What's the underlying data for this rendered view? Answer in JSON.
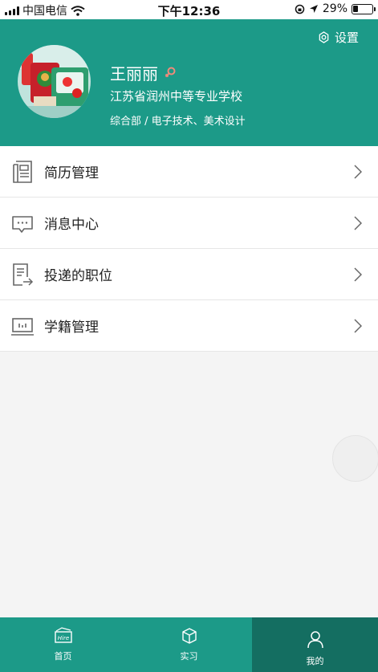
{
  "status_bar": {
    "carrier": "中国电信",
    "time": "下午12:36",
    "battery": "29%",
    "battery_level": 0.29
  },
  "header": {
    "settings_label": "设置",
    "name": "王丽丽",
    "school": "江苏省润州中等专业学校",
    "department": "综合部 / 电子技术、美术设计"
  },
  "menu": {
    "items": [
      {
        "label": "简历管理",
        "icon": "resume-icon"
      },
      {
        "label": "消息中心",
        "icon": "message-icon"
      },
      {
        "label": "投递的职位",
        "icon": "delivered-jobs-icon"
      },
      {
        "label": "学籍管理",
        "icon": "student-status-icon"
      }
    ]
  },
  "tabbar": {
    "tabs": [
      {
        "label": "首页",
        "icon": "hire-icon",
        "icon_text": "Hire"
      },
      {
        "label": "实习",
        "icon": "cube-icon"
      },
      {
        "label": "我的",
        "icon": "person-icon",
        "active": true
      }
    ]
  },
  "colors": {
    "brand": "#1c9a88",
    "brand_dark": "#146e61",
    "gender_icon": "#f08a7a"
  }
}
